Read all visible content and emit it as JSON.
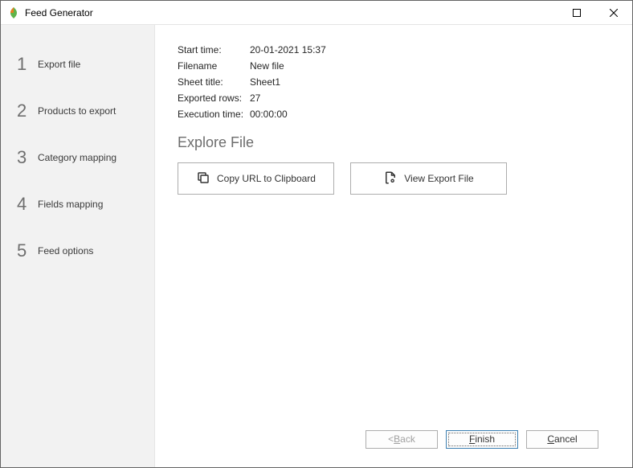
{
  "window": {
    "title": "Feed Generator"
  },
  "sidebar": {
    "steps": [
      {
        "num": "1",
        "label": "Export file"
      },
      {
        "num": "2",
        "label": "Products to export"
      },
      {
        "num": "3",
        "label": "Category mapping"
      },
      {
        "num": "4",
        "label": "Fields mapping"
      },
      {
        "num": "5",
        "label": "Feed options"
      }
    ]
  },
  "info": {
    "start_time_label": "Start time:",
    "start_time_value": "20-01-2021 15:37",
    "filename_label": "Filename",
    "filename_value": "New file",
    "sheet_title_label": "Sheet title:",
    "sheet_title_value": "Sheet1",
    "exported_rows_label": "Exported rows:",
    "exported_rows_value": "27",
    "execution_time_label": "Execution time:",
    "execution_time_value": "00:00:00"
  },
  "section_heading": "Explore File",
  "buttons": {
    "copy_url": "Copy URL to Clipboard",
    "view_export": "View Export File"
  },
  "footer": {
    "back_lt": "< ",
    "back_u": "B",
    "back_rest": "ack",
    "finish_u": "F",
    "finish_rest": "inish",
    "cancel_u": "C",
    "cancel_rest": "ancel"
  }
}
